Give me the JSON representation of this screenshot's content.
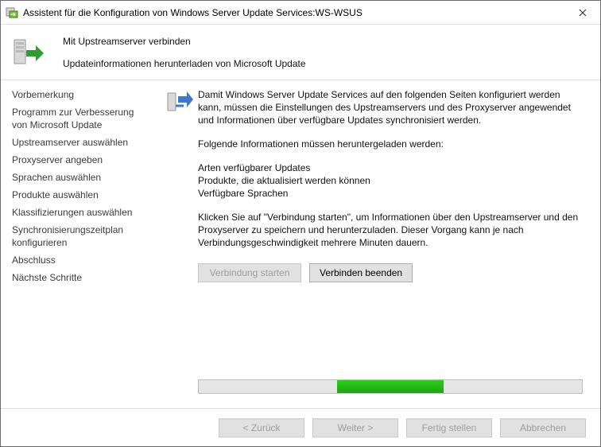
{
  "window": {
    "title": "Assistent für die Konfiguration von Windows Server Update Services:WS-WSUS"
  },
  "header": {
    "title": "Mit Upstreamserver verbinden",
    "subtitle": "Updateinformationen herunterladen von Microsoft Update"
  },
  "sidebar": {
    "items": [
      {
        "label": "Vorbemerkung"
      },
      {
        "label": "Programm zur Verbesserung von Microsoft Update"
      },
      {
        "label": "Upstreamserver auswählen"
      },
      {
        "label": "Proxyserver angeben"
      },
      {
        "label": "Sprachen auswählen"
      },
      {
        "label": "Produkte auswählen"
      },
      {
        "label": "Klassifizierungen auswählen"
      },
      {
        "label": "Synchronisierungszeitplan konfigurieren"
      },
      {
        "label": "Abschluss"
      },
      {
        "label": "Nächste Schritte"
      }
    ]
  },
  "content": {
    "para1": "Damit Windows Server Update Services auf den folgenden Seiten konfiguriert werden kann, müssen die Einstellungen des Upstreamservers und des Proxyserver angewendet und Informationen über verfügbare Updates synchronisiert werden.",
    "para2": "Folgende Informationen müssen heruntergeladen werden:",
    "list": [
      "Arten verfügbarer Updates",
      "Produkte, die aktualisiert werden können",
      "Verfügbare Sprachen"
    ],
    "para3": "Klicken Sie auf \"Verbindung starten\", um Informationen über den Upstreamserver und den Proxyserver zu speichern und herunterzuladen. Dieser Vorgang kann je nach Verbindungsgeschwindigkeit mehrere Minuten dauern.",
    "buttons": {
      "start": "Verbindung starten",
      "stop": "Verbinden beenden"
    }
  },
  "footer": {
    "back": "< Zurück",
    "next": "Weiter >",
    "finish": "Fertig stellen",
    "cancel": "Abbrechen"
  }
}
